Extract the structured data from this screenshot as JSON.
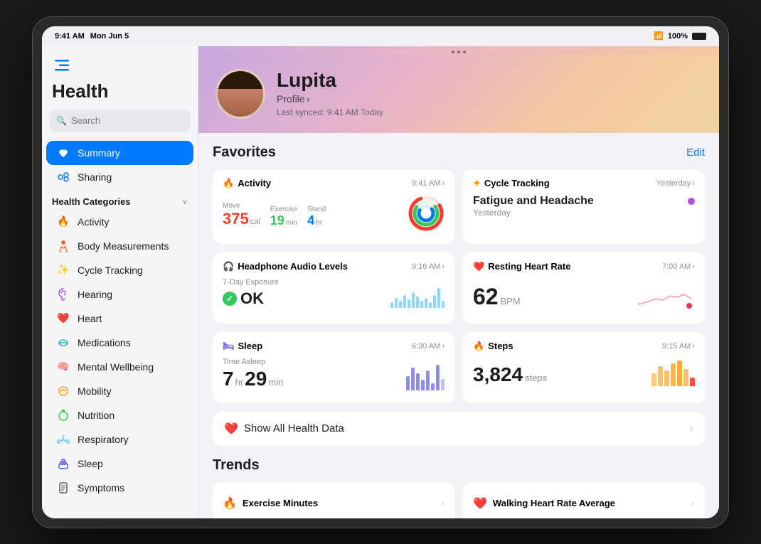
{
  "statusBar": {
    "time": "9:41 AM",
    "date": "Mon Jun 5",
    "wifi": "WiFi",
    "battery": "100%"
  },
  "sidebar": {
    "title": "Health",
    "search": {
      "placeholder": "Search"
    },
    "navItems": [
      {
        "id": "summary",
        "label": "Summary",
        "icon": "heart",
        "active": true
      },
      {
        "id": "sharing",
        "label": "Sharing",
        "icon": "sharing",
        "active": false
      }
    ],
    "categoriesHeader": "Health Categories",
    "categories": [
      {
        "id": "activity",
        "label": "Activity",
        "color": "#ff3b30",
        "icon": "🔥"
      },
      {
        "id": "body",
        "label": "Body Measurements",
        "color": "#ff6b35",
        "icon": "🏃"
      },
      {
        "id": "cycle",
        "label": "Cycle Tracking",
        "color": "#ff9500",
        "icon": "✨"
      },
      {
        "id": "hearing",
        "label": "Hearing",
        "color": "#af52de",
        "icon": "👂"
      },
      {
        "id": "heart",
        "label": "Heart",
        "color": "#ff2d55",
        "icon": "❤️"
      },
      {
        "id": "medications",
        "label": "Medications",
        "color": "#30b0c7",
        "icon": "💊"
      },
      {
        "id": "mental",
        "label": "Mental Wellbeing",
        "color": "#34c759",
        "icon": "🧠"
      },
      {
        "id": "mobility",
        "label": "Mobility",
        "color": "#ff9f0a",
        "icon": "🔄"
      },
      {
        "id": "nutrition",
        "label": "Nutrition",
        "color": "#30d158",
        "icon": "🥗"
      },
      {
        "id": "respiratory",
        "label": "Respiratory",
        "color": "#5ac8fa",
        "icon": "💨"
      },
      {
        "id": "sleep",
        "label": "Sleep",
        "color": "#5e5ce6",
        "icon": "🌙"
      },
      {
        "id": "symptoms",
        "label": "Symptoms",
        "color": "#636366",
        "icon": "📋"
      }
    ]
  },
  "profile": {
    "name": "Lupita",
    "profileLink": "Profile",
    "lastSynced": "Last synced: 9:41 AM Today"
  },
  "favorites": {
    "title": "Favorites",
    "editLabel": "Edit",
    "cards": {
      "activity": {
        "title": "Activity",
        "time": "9:41 AM",
        "move": {
          "label": "Move",
          "value": "375",
          "unit": "cal"
        },
        "exercise": {
          "label": "Exercise",
          "value": "19",
          "unit": "min"
        },
        "stand": {
          "label": "Stand",
          "value": "4",
          "unit": "hr"
        }
      },
      "cycleTracking": {
        "title": "Cycle Tracking",
        "time": "Yesterday",
        "event": "Fatigue and Headache",
        "eventTime": "Yesterday"
      },
      "headphone": {
        "title": "Headphone Audio Levels",
        "time": "9:16 AM",
        "label": "7-Day Exposure",
        "status": "OK"
      },
      "restingHeart": {
        "title": "Resting Heart Rate",
        "time": "7:00 AM",
        "value": "62",
        "unit": "BPM"
      },
      "sleep": {
        "title": "Sleep",
        "time": "6:30 AM",
        "label": "Time Asleep",
        "hours": "7",
        "minutes": "29",
        "hoursUnit": "hr",
        "minutesUnit": "min"
      },
      "steps": {
        "title": "Steps",
        "time": "9:15 AM",
        "value": "3,824",
        "unit": "steps"
      }
    },
    "showAllLabel": "Show All Health Data"
  },
  "trends": {
    "title": "Trends",
    "items": [
      {
        "id": "exercise",
        "label": "Exercise Minutes",
        "color": "#ff3b30",
        "icon": "🔥"
      },
      {
        "id": "walkingHR",
        "label": "Walking Heart Rate Average",
        "color": "#ff2d55",
        "icon": "❤️"
      }
    ]
  }
}
